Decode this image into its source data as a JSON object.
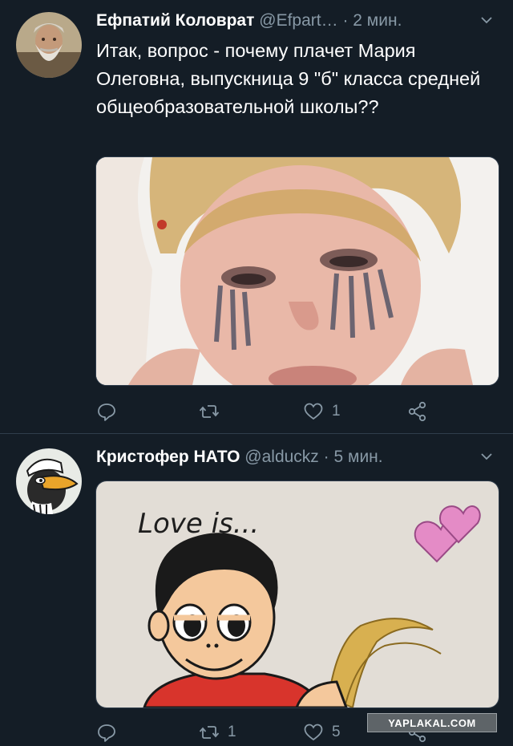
{
  "tweets": [
    {
      "author": "Ефпатий Коловрат",
      "handle": "@Efpart…",
      "separator": "·",
      "time": "2 мин.",
      "text": "Итак, вопрос - почему плачет Мария Олеговна, выпускница 9 \"б\" класса средней общеобразовательной школы??",
      "avatar_icon": "bearded-man-avatar",
      "media_icon": "crying-woman-photo",
      "actions": {
        "reply_count": "",
        "retweet_count": "",
        "like_count": "1"
      }
    },
    {
      "author": "Кристофер НАТО",
      "handle": "@alduckz",
      "separator": "·",
      "time": "5 мин.",
      "text": "",
      "avatar_icon": "duck-cartoon-avatar",
      "media_caption": "Love is...",
      "media_icon": "love-is-cartoon",
      "actions": {
        "reply_count": "",
        "retweet_count": "1",
        "like_count": "5"
      }
    }
  ],
  "watermark": "YAPLAKAL.COM",
  "colors": {
    "background": "#141d26",
    "secondary_text": "#8899a6",
    "divider": "#2f3d4c"
  }
}
